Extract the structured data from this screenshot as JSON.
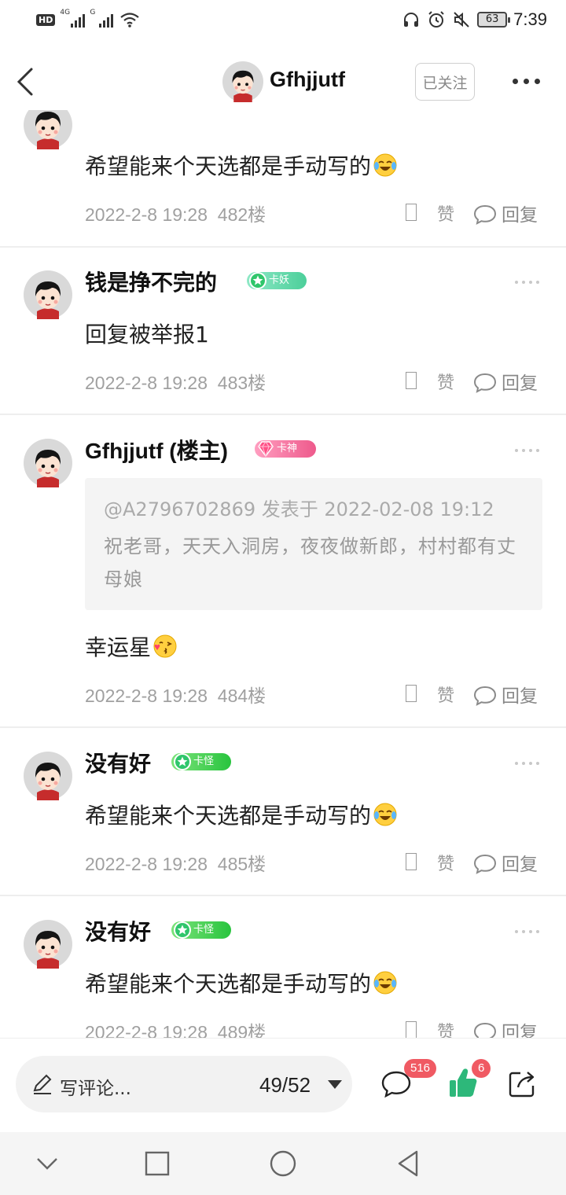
{
  "status_bar": {
    "hd": "HD",
    "net1": "4G",
    "net2": "G",
    "battery": "63",
    "time": "7:39"
  },
  "header": {
    "username": "Gfhjjutf",
    "follow_label": "已关注"
  },
  "posts": [
    {
      "content": "希望能来个天选都是手动写的",
      "emoji": "cry-laugh-emoji",
      "time": "2022-2-8 19:28",
      "floor": "482楼",
      "like": "赞",
      "reply": "回复"
    },
    {
      "username": "钱是挣不完的",
      "badge": "卡妖",
      "content": "回复被举报1",
      "time": "2022-2-8 19:28",
      "floor": "483楼",
      "like": "赞",
      "reply": "回复"
    },
    {
      "username": "Gfhjjutf (楼主)",
      "badge": "卡神",
      "quote_head": "@A2796702869 发表于 2022-02-08 19:12",
      "quote_body": "祝老哥，天天入洞房，夜夜做新郎，村村都有丈母娘",
      "content": "幸运星",
      "emoji": "kiss-emoji",
      "time": "2022-2-8 19:28",
      "floor": "484楼",
      "like": "赞",
      "reply": "回复"
    },
    {
      "username": "没有好",
      "badge": "卡怪",
      "content": "希望能来个天选都是手动写的",
      "emoji": "cry-laugh-emoji",
      "time": "2022-2-8 19:28",
      "floor": "485楼",
      "like": "赞",
      "reply": "回复"
    },
    {
      "username": "没有好",
      "badge": "卡怪",
      "content": "希望能来个天选都是手动写的",
      "emoji": "cry-laugh-emoji",
      "time": "2022-2-8 19:28",
      "floor": "489楼",
      "like": "赞",
      "reply": "回复"
    }
  ],
  "bottom_bar": {
    "placeholder": "写评论...",
    "page_indicator": "49/52",
    "comment_count": "516",
    "like_count": "6"
  },
  "colors": {
    "accent_green": "#2db87a",
    "badge_red": "#f05a63",
    "meta_gray": "#a0a0a0"
  }
}
